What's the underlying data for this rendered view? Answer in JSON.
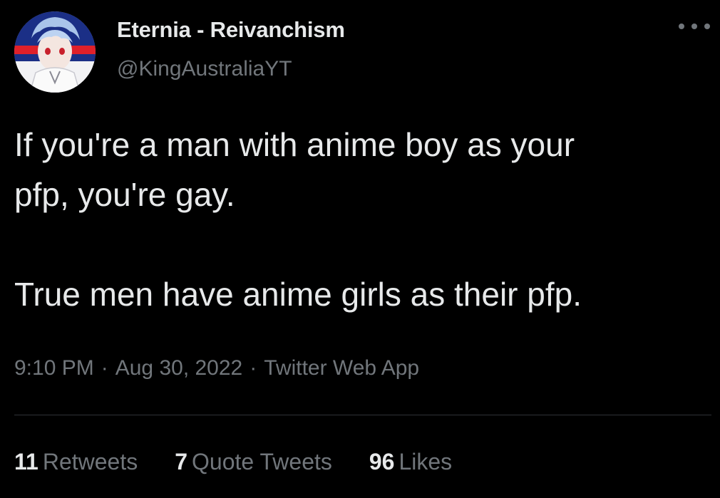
{
  "user": {
    "display_name": "Eternia - Reivanchism",
    "handle": "@KingAustraliaYT",
    "avatar_icon": "profile-avatar"
  },
  "more_icon": "ellipsis-icon",
  "tweet": {
    "text": "If you're a man with anime boy as your\npfp, you're gay.\n\nTrue men have anime girls as their pfp.",
    "time": "9:10 PM",
    "date": "Aug 30, 2022",
    "source": "Twitter Web App",
    "separator": "·"
  },
  "stats": {
    "retweets_count": "11",
    "retweets_label": "Retweets",
    "quotes_count": "7",
    "quotes_label": "Quote Tweets",
    "likes_count": "96",
    "likes_label": "Likes"
  },
  "colors": {
    "background": "#000000",
    "primary_text": "#e7e9ea",
    "secondary_text": "#71767b",
    "divider": "#2f3336"
  }
}
